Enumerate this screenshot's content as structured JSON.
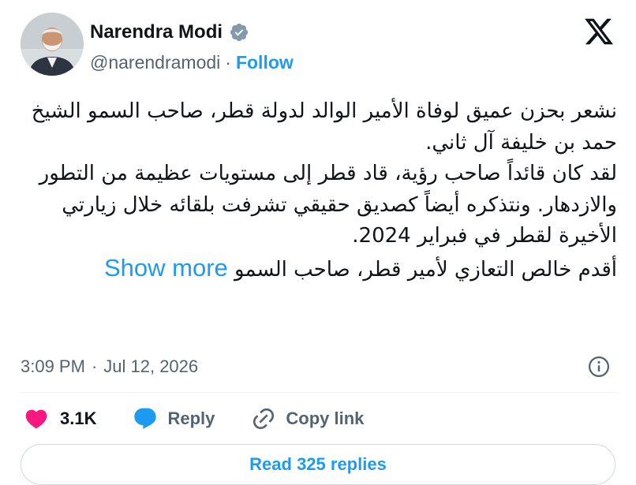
{
  "author": {
    "name": "Narendra Modi",
    "handle": "@narendramodi",
    "separator": "·",
    "follow_label": "Follow",
    "verified": true
  },
  "post": {
    "paragraphs": [
      "نشعر بحزن عميق لوفاة الأمير الوالد لدولة قطر، صاحب السمو الشيخ حمد بن خليفة آل ثاني.",
      "لقد كان قائداً صاحب رؤية، قاد قطر إلى مستويات عظيمة من التطور والازدهار. ونتذكره أيضاً كصديق حقيقي تشرفت بلقائه خلال زيارتي الأخيرة لقطر في فبراير 2024.",
      "أقدم خالص التعازي لأمير قطر، صاحب السمو"
    ],
    "show_more_label": "Show more"
  },
  "meta": {
    "time": "3:09 PM",
    "separator": "·",
    "date": "Jul 12, 2026"
  },
  "actions": {
    "like_count": "3.1K",
    "reply_label": "Reply",
    "copy_link_label": "Copy link"
  },
  "read_replies_label": "Read 325 replies",
  "colors": {
    "accent": "#1d9bf0",
    "like": "#f91880",
    "text": "#0f1419",
    "muted": "#536471",
    "border": "#cfd9de"
  },
  "icons": {
    "brand": "x-logo-icon",
    "verified": "verified-badge-icon",
    "info": "info-icon",
    "like": "heart-icon",
    "reply": "speech-bubble-icon",
    "copy": "link-icon"
  }
}
